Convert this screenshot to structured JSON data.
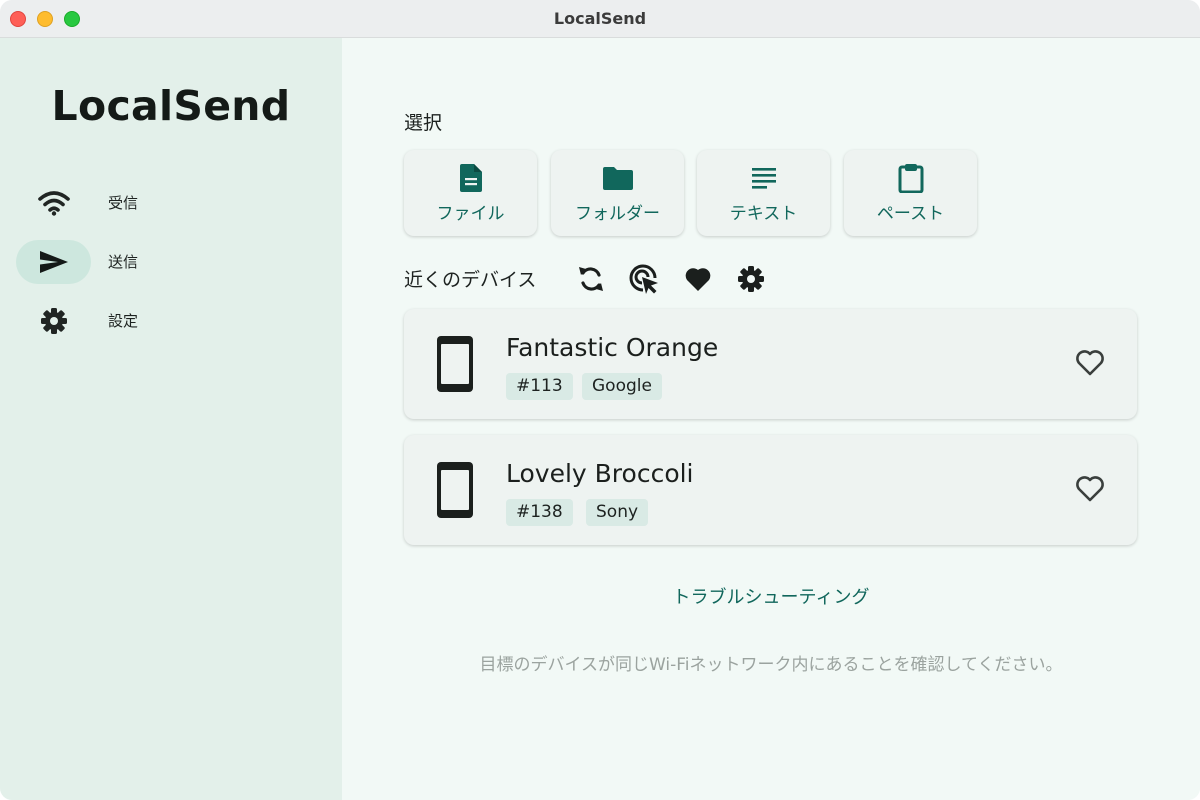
{
  "window": {
    "title": "LocalSend"
  },
  "sidebar": {
    "app_title": "LocalSend",
    "items": [
      {
        "label": "受信",
        "icon": "wifi-icon",
        "active": false
      },
      {
        "label": "送信",
        "icon": "send-icon",
        "active": true
      },
      {
        "label": "設定",
        "icon": "gear-icon",
        "active": false
      }
    ]
  },
  "main": {
    "selection_title": "選択",
    "selection_buttons": [
      {
        "label": "ファイル",
        "icon": "file-icon"
      },
      {
        "label": "フォルダー",
        "icon": "folder-icon"
      },
      {
        "label": "テキスト",
        "icon": "text-icon"
      },
      {
        "label": "ペースト",
        "icon": "clipboard-icon"
      }
    ],
    "nearby_title": "近くのデバイス",
    "nearby_tools": [
      "refresh-icon",
      "target-click-icon",
      "favorite-heart-icon",
      "gear-icon"
    ],
    "devices": [
      {
        "name": "Fantastic Orange",
        "tags": [
          "#113",
          "Google"
        ]
      },
      {
        "name": "Lovely Broccoli",
        "tags": [
          "#138",
          "Sony"
        ]
      }
    ],
    "troubleshoot_link": "トラブルシューティング",
    "hint": "目標のデバイスが同じWi-Fiネットワーク内にあることを確認してください。"
  },
  "colors": {
    "accent": "#11675c",
    "sidebar_bg": "#e3f0ea",
    "main_bg": "#f2f9f6",
    "active_nav": "#cde7de",
    "tag_bg": "#d9eae5"
  }
}
